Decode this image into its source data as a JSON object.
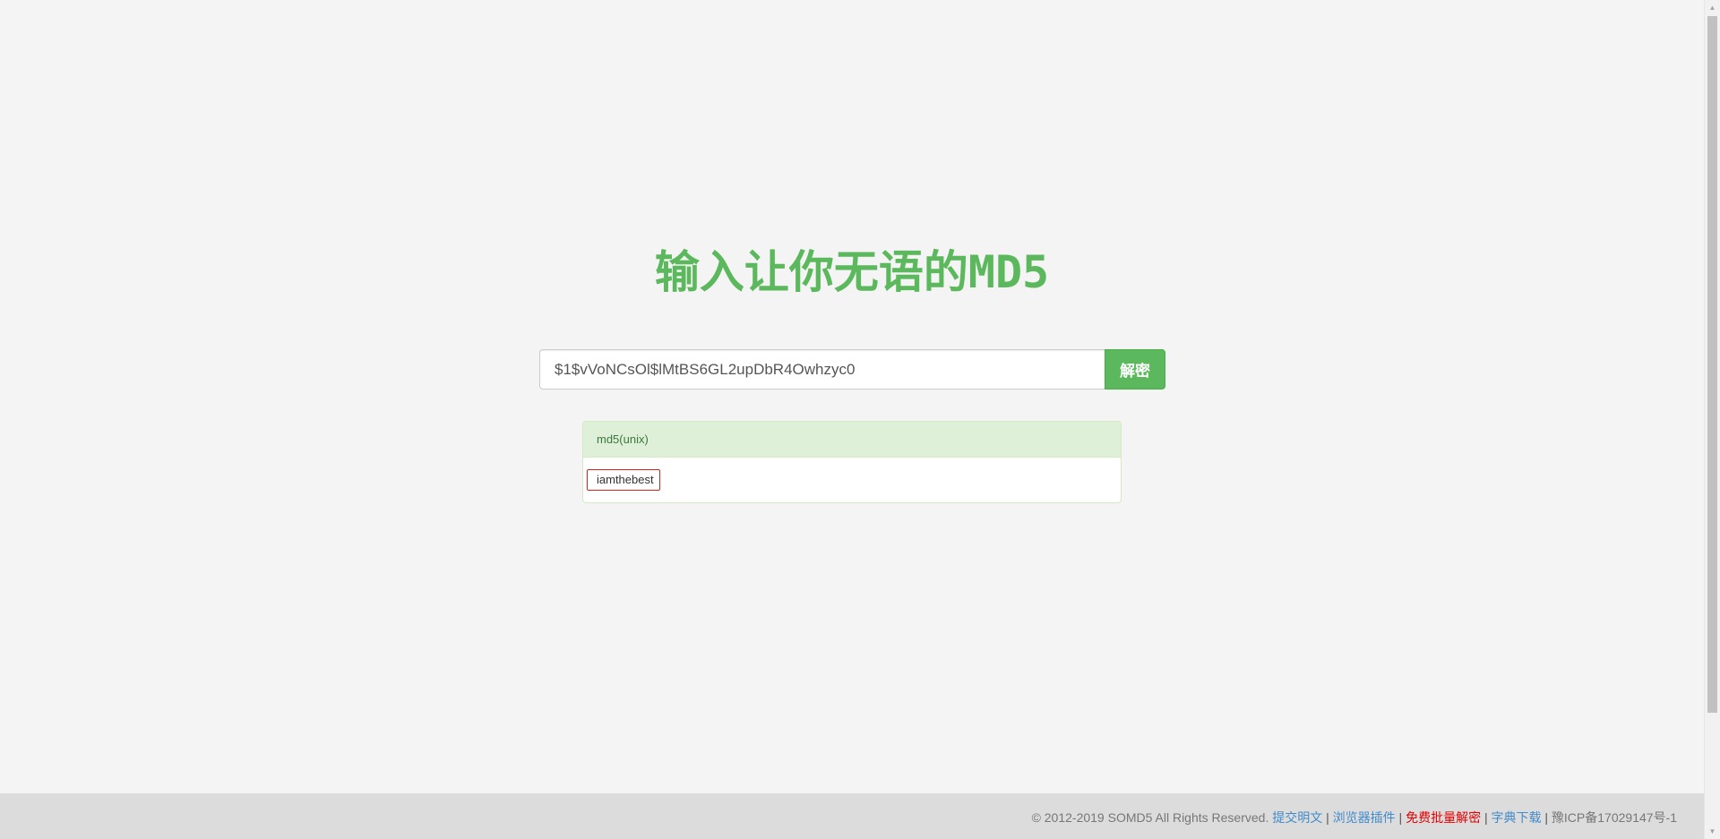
{
  "header": {
    "title": "输入让你无语的MD5"
  },
  "search": {
    "value": "$1$vVoNCsOl$lMtBS6GL2upDbR4Owhzyc0",
    "button_label": "解密"
  },
  "result": {
    "type_label": "md5(unix)",
    "value": "iamthebest",
    "border_color": "#d9231d"
  },
  "footer": {
    "copyright": "© 2012-2019 SOMD5 All Rights Reserved.",
    "links": [
      {
        "label": "提交明文"
      },
      {
        "label": "浏览器插件"
      },
      {
        "label": "免费批量解密"
      },
      {
        "label": "字典下载"
      }
    ],
    "icp": "豫ICP备17029147号-1",
    "separator": "|"
  },
  "colors": {
    "accent": "#5cb85c",
    "link": "#428bca",
    "hot_link": "#e60000",
    "background": "#f4f4f4",
    "footer_bg": "#dcdcdc"
  },
  "scrollbar": {
    "up_icon": "arrow-up-icon",
    "down_icon": "arrow-down-icon"
  }
}
